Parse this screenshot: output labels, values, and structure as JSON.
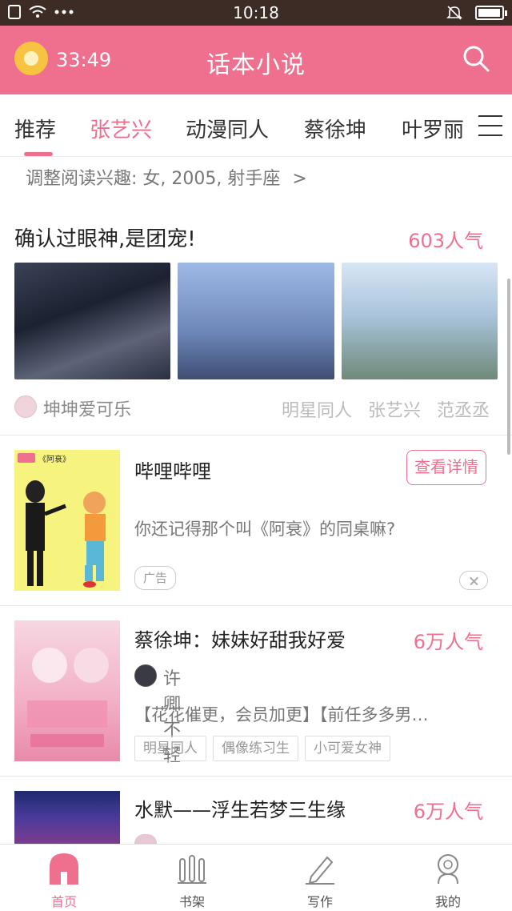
{
  "status_bar": {
    "time": "10:18",
    "left_icons": [
      "sim-icon",
      "wifi-icon",
      "more-dots-icon"
    ],
    "right_icons": [
      "mute-icon",
      "battery-icon"
    ],
    "battery_level": 0.95
  },
  "header": {
    "timer": "33:49",
    "title": "话本小说",
    "accent_color": "#ef6f8f"
  },
  "tabs": [
    {
      "label": "推荐",
      "active": true
    },
    {
      "label": "张艺兴"
    },
    {
      "label": "动漫同人"
    },
    {
      "label": "蔡徐坤"
    },
    {
      "label": "叶罗丽"
    }
  ],
  "interest": {
    "text": "调整阅读兴趣: 女, 2005, 射手座",
    "chevron": ">"
  },
  "featured": {
    "title": "确认过眼神,是团宠!",
    "popularity": "603人气",
    "author": "坤坤爱可乐",
    "tags": [
      "明星同人",
      "张艺兴",
      "范丞丞"
    ]
  },
  "ad_card": {
    "cover_caption": "《阿衰》",
    "title": "哔哩哔哩",
    "detail_button": "查看详情",
    "description": "你还记得那个叫《阿衰》的同桌嘛?",
    "badge": "广告"
  },
  "cards": [
    {
      "title": "蔡徐坤：妹妹好甜我好爱",
      "popularity": "6万人气",
      "author": "许卿不轻",
      "description": "【花花催更，会员加更】【前任多多男…",
      "tags": [
        "明星同人",
        "偶像练习生",
        "小可爱女神"
      ]
    },
    {
      "title": "水默——浮生若梦三生缘",
      "popularity": "6万人气"
    }
  ],
  "bottom_nav": [
    {
      "label": "首页",
      "icon": "home-icon",
      "active": true
    },
    {
      "label": "书架",
      "icon": "bookshelf-icon"
    },
    {
      "label": "写作",
      "icon": "pen-icon"
    },
    {
      "label": "我的",
      "icon": "profile-icon"
    }
  ]
}
